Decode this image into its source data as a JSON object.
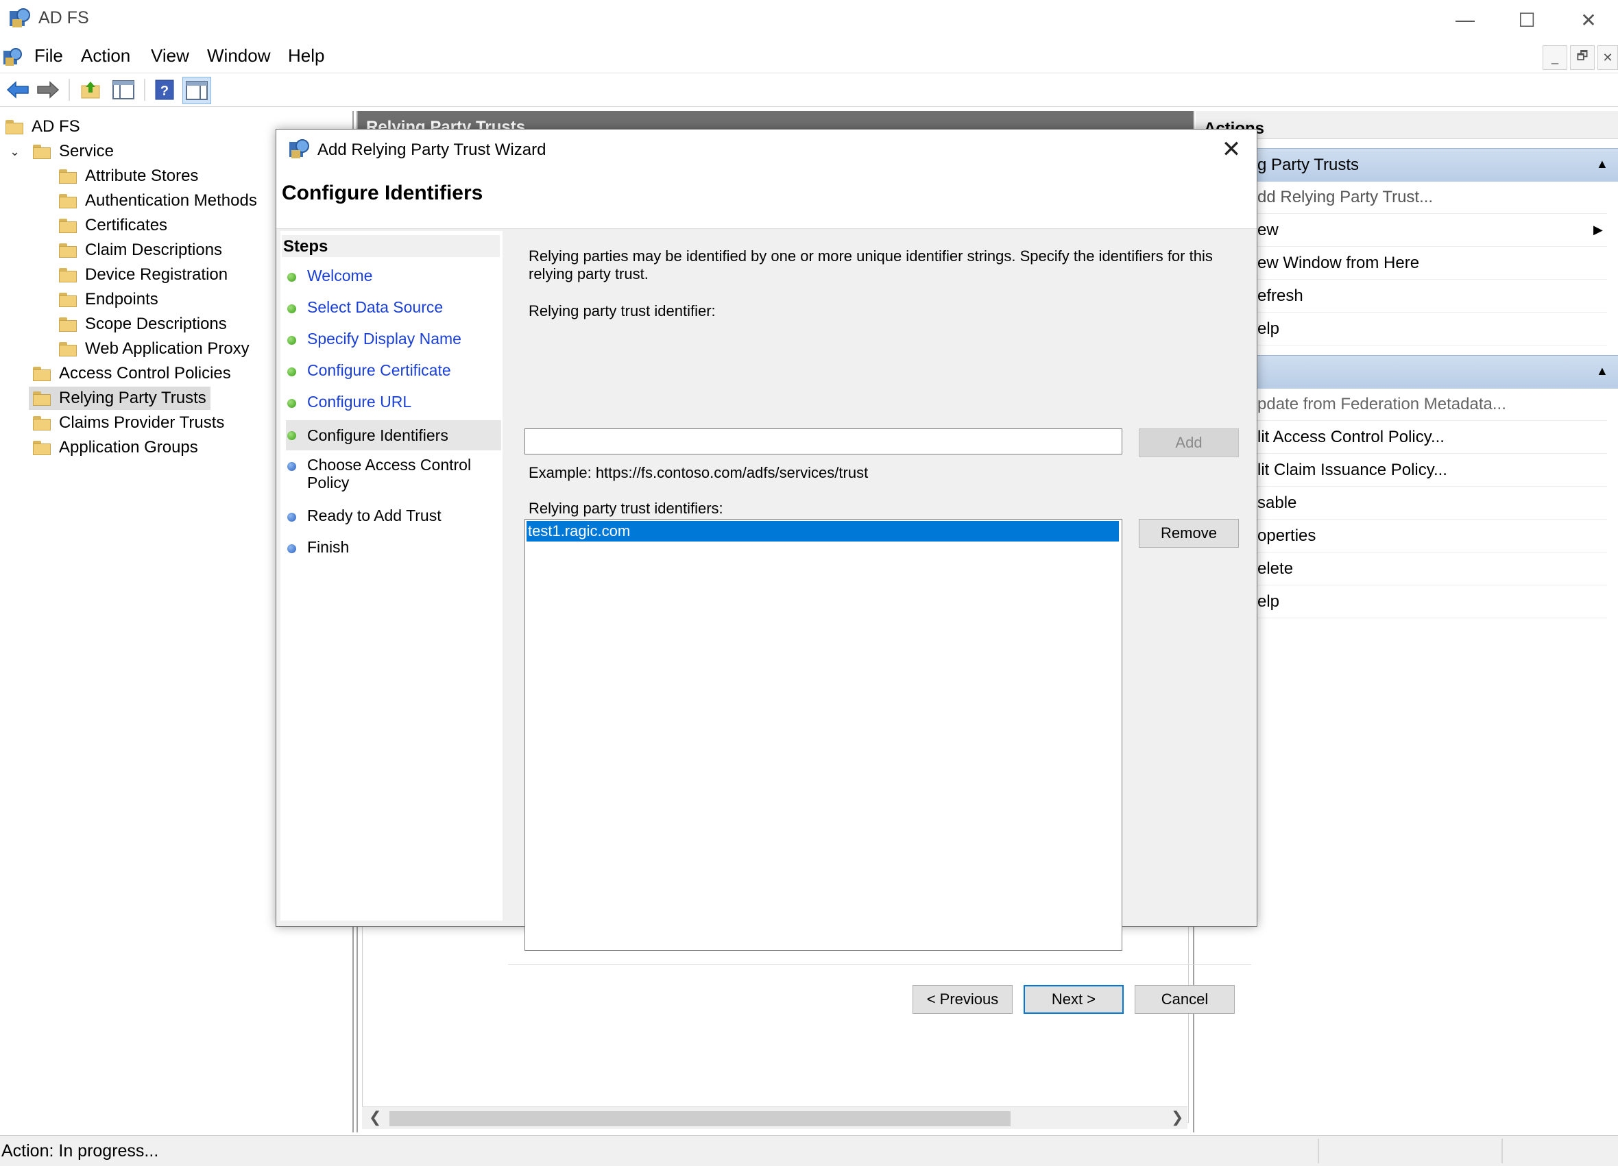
{
  "window": {
    "title": "AD FS",
    "controls": {
      "minimize": "—",
      "maximize": "☐",
      "close": "✕"
    }
  },
  "menu": {
    "items": [
      "File",
      "Action",
      "View",
      "Window",
      "Help"
    ],
    "mdi_controls": [
      "_",
      "🗗",
      "✕"
    ]
  },
  "tree": {
    "root": "AD FS",
    "items": [
      {
        "label": "Service",
        "level": 1,
        "expanded": true
      },
      {
        "label": "Attribute Stores",
        "level": 2
      },
      {
        "label": "Authentication Methods",
        "level": 2
      },
      {
        "label": "Certificates",
        "level": 2
      },
      {
        "label": "Claim Descriptions",
        "level": 2
      },
      {
        "label": "Device Registration",
        "level": 2
      },
      {
        "label": "Endpoints",
        "level": 2
      },
      {
        "label": "Scope Descriptions",
        "level": 2
      },
      {
        "label": "Web Application Proxy",
        "level": 2
      },
      {
        "label": "Access Control Policies",
        "level": 1
      },
      {
        "label": "Relying Party Trusts",
        "level": 1,
        "selected": true
      },
      {
        "label": "Claims Provider Trusts",
        "level": 1
      },
      {
        "label": "Application Groups",
        "level": 1
      }
    ]
  },
  "middle": {
    "header": "Relying Party Trusts"
  },
  "actions": {
    "title": "Actions",
    "section1": "g Party Trusts",
    "section1_items": [
      "dd Relying Party Trust...",
      "ew",
      "ew Window from Here",
      "efresh",
      "elp"
    ],
    "section2_items": [
      "pdate from Federation Metadata...",
      "lit Access Control Policy...",
      "lit Claim Issuance Policy...",
      "sable",
      "operties",
      "elete",
      "elp"
    ]
  },
  "status": {
    "text": "Action:  In progress..."
  },
  "dialog": {
    "title": "Add Relying Party Trust Wizard",
    "close": "✕",
    "heading": "Configure Identifiers",
    "steps_title": "Steps",
    "steps": [
      {
        "label": "Welcome",
        "state": "done"
      },
      {
        "label": "Select Data Source",
        "state": "done"
      },
      {
        "label": "Specify Display Name",
        "state": "done"
      },
      {
        "label": "Configure Certificate",
        "state": "done"
      },
      {
        "label": "Configure URL",
        "state": "done"
      },
      {
        "label": "Configure Identifiers",
        "state": "current"
      },
      {
        "label": "Choose Access Control Policy",
        "state": "pending"
      },
      {
        "label": "Ready to Add Trust",
        "state": "pending"
      },
      {
        "label": "Finish",
        "state": "pending"
      }
    ],
    "description": "Relying parties may be identified by one or more unique identifier strings. Specify the identifiers for this relying party trust.",
    "identifier_label": "Relying party trust identifier:",
    "identifier_value": "",
    "add_button": "Add",
    "example": "Example: https://fs.contoso.com/adfs/services/trust",
    "identifiers_label": "Relying party trust identifiers:",
    "identifiers": [
      "test1.ragic.com"
    ],
    "remove_button": "Remove",
    "previous_button": "< Previous",
    "next_button": "Next >",
    "cancel_button": "Cancel"
  },
  "colors": {
    "link": "#1a3fd4",
    "selection": "#0078d7",
    "step_done": "#3aa016",
    "step_pending": "#2a62c4"
  }
}
